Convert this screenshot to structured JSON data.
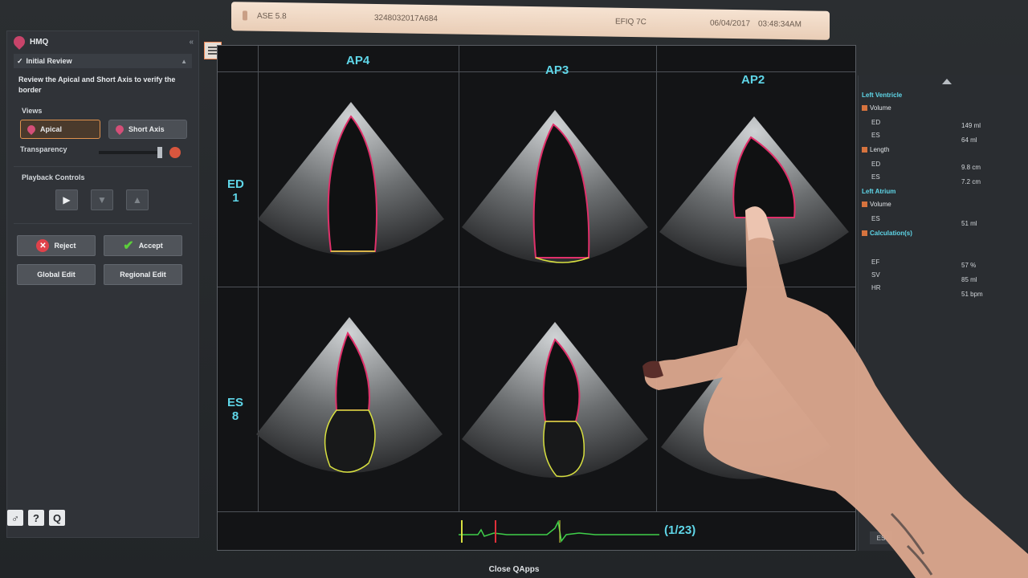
{
  "patient_bar": {
    "study": "ASE 5.8",
    "patient_id": "3248032017A684",
    "probe": "EFIQ 7C",
    "date": "06/04/2017",
    "time": "03:48:34AM"
  },
  "left_panel": {
    "app_title": "HMQ",
    "step": "Initial Review",
    "instructions": "Review the Apical and Short Axis to verify the border",
    "views_label": "Views",
    "views": [
      "Apical",
      "Short Axis"
    ],
    "selected_view": "Apical",
    "transparency_label": "Transparency",
    "transparency_level": 1.0,
    "playback_label": "Playback Controls",
    "reject_label": "Reject",
    "accept_label": "Accept",
    "global_edit_label": "Global Edit",
    "regional_edit_label": "Regional Edit",
    "bottom_icons": [
      "tools-icon",
      "help-icon",
      "search-icon"
    ],
    "help_glyph": "?",
    "search_glyph": "Q"
  },
  "grid": {
    "columns": [
      "AP4",
      "AP3",
      "AP2"
    ],
    "rows": [
      {
        "phase": "ED",
        "frame": "1"
      },
      {
        "phase": "ES",
        "frame": "8"
      }
    ],
    "frame_counter": "(1/23)"
  },
  "results": {
    "left_ventricle_title": "Left Ventricle",
    "volume_label": "Volume",
    "lv_volume": [
      {
        "key": "ED",
        "value": "149 ml"
      },
      {
        "key": "ES",
        "value": "64 ml"
      }
    ],
    "length_label": "Length",
    "lv_length": [
      {
        "key": "ED",
        "value": "9.8 cm"
      },
      {
        "key": "ES",
        "value": "7.2 cm"
      }
    ],
    "left_atrium_title": "Left Atrium",
    "la_volume_label": "Volume",
    "la_volume": [
      {
        "key": "ES",
        "value": "51 ml"
      }
    ],
    "calculations_label": "Calculation(s)",
    "calculations": [
      {
        "key": "EF",
        "value": "57 %"
      },
      {
        "key": "SV",
        "value": "85 ml"
      },
      {
        "key": "HR",
        "value": "51 bpm"
      }
    ],
    "bottom_button": "ES"
  },
  "footer": {
    "close_label": "Close QApps"
  },
  "colors": {
    "accent_cyan": "#5fd6e8",
    "lv_contour": "#e0306a",
    "la_contour": "#d8e040",
    "ecg": "#3fcf4a",
    "selected_orange": "#e0924e"
  }
}
